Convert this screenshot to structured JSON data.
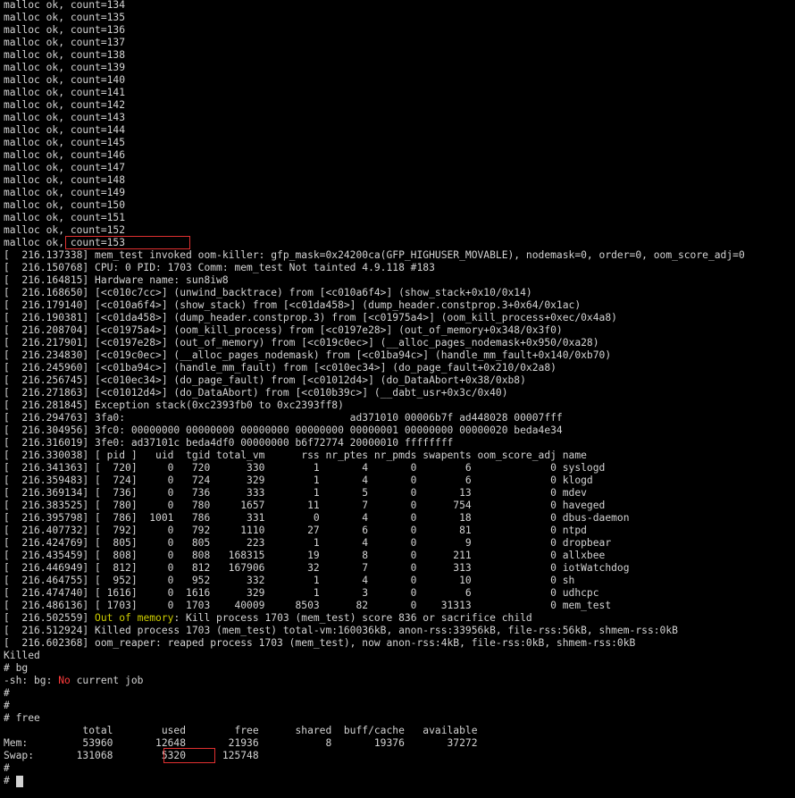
{
  "terminal": {
    "lines": [
      "malloc ok, count=134",
      "malloc ok, count=135",
      "malloc ok, count=136",
      "malloc ok, count=137",
      "malloc ok, count=138",
      "malloc ok, count=139",
      "malloc ok, count=140",
      "malloc ok, count=141",
      "malloc ok, count=142",
      "malloc ok, count=143",
      "malloc ok, count=144",
      "malloc ok, count=145",
      "malloc ok, count=146",
      "malloc ok, count=147",
      "malloc ok, count=148",
      "malloc ok, count=149",
      "malloc ok, count=150",
      "malloc ok, count=151",
      "malloc ok, count=152",
      "malloc ok, count=153",
      "[  216.137338] mem_test invoked oom-killer: gfp_mask=0x24200ca(GFP_HIGHUSER_MOVABLE), nodemask=0, order=0, oom_score_adj=0",
      "[  216.150768] CPU: 0 PID: 1703 Comm: mem_test Not tainted 4.9.118 #183",
      "[  216.164815] Hardware name: sun8iw8",
      "[  216.168650] [<c010c7cc>] (unwind_backtrace) from [<c010a6f4>] (show_stack+0x10/0x14)",
      "[  216.179140] [<c010a6f4>] (show_stack) from [<c01da458>] (dump_header.constprop.3+0x64/0x1ac)",
      "[  216.190381] [<c01da458>] (dump_header.constprop.3) from [<c01975a4>] (oom_kill_process+0xec/0x4a8)",
      "[  216.208704] [<c01975a4>] (oom_kill_process) from [<c0197e28>] (out_of_memory+0x348/0x3f0)",
      "[  216.217901] [<c0197e28>] (out_of_memory) from [<c019c0ec>] (__alloc_pages_nodemask+0x950/0xa28)",
      "[  216.234830] [<c019c0ec>] (__alloc_pages_nodemask) from [<c01ba94c>] (handle_mm_fault+0x140/0xb70)",
      "[  216.245960] [<c01ba94c>] (handle_mm_fault) from [<c010ec34>] (do_page_fault+0x210/0x2a8)",
      "[  216.256745] [<c010ec34>] (do_page_fault) from [<c01012d4>] (do_DataAbort+0x38/0xb8)",
      "[  216.271863] [<c01012d4>] (do_DataAbort) from [<c010b39c>] (__dabt_usr+0x3c/0x40)",
      "[  216.281845] Exception stack(0xc2393fb0 to 0xc2393ff8)",
      "[  216.294763] 3fa0:                                     ad371010 00006b7f ad448028 00007fff",
      "[  216.304956] 3fc0: 00000000 00000000 00000000 00000000 00000001 00000000 00000020 beda4e34",
      "[  216.316019] 3fe0: ad37101c beda4df0 00000000 b6f72774 20000010 ffffffff",
      "[  216.330038] [ pid ]   uid  tgid total_vm      rss nr_ptes nr_pmds swapents oom_score_adj name",
      "[  216.341363] [  720]     0   720      330        1       4       0        6             0 syslogd",
      "[  216.359483] [  724]     0   724      329        1       4       0        6             0 klogd",
      "[  216.369134] [  736]     0   736      333        1       5       0       13             0 mdev",
      "[  216.383525] [  780]     0   780     1657       11       7       0      754             0 haveged",
      "[  216.395798] [  786]  1001   786      331        0       4       0       18             0 dbus-daemon",
      "[  216.407732] [  792]     0   792     1110       27       6       0       81             0 ntpd",
      "[  216.424769] [  805]     0   805      223        1       4       0        9             0 dropbear",
      "[  216.435459] [  808]     0   808   168315       19       8       0      211             0 allxbee",
      "[  216.446949] [  812]     0   812   167906       32       7       0      313             0 iotWatchdog",
      "[  216.464755] [  952]     0   952      332        1       4       0       10             0 sh",
      "[  216.474740] [ 1616]     0  1616      329        1       3       0        6             0 udhcpc",
      "[  216.486136] [ 1703]     0  1703    40009     8503      82       0    31313             0 mem_test"
    ],
    "oom_prefix": "[  216.502559] ",
    "oom_highlight": "Out of memory",
    "oom_rest": ": Kill process 1703 (mem_test) score 836 or sacrifice child",
    "after_lines": [
      "[  216.512924] Killed process 1703 (mem_test) total-vm:160036kB, anon-rss:33956kB, file-rss:56kB, shmem-rss:0kB",
      "[  216.602368] oom_reaper: reaped process 1703 (mem_test), now anon-rss:4kB, file-rss:0kB, shmem-rss:0kB",
      "Killed",
      "# bg"
    ],
    "bg_prefix": "-sh: bg: ",
    "bg_highlight": "No",
    "bg_rest": " current job",
    "tail_lines": [
      "#",
      "#",
      "# free",
      "             total        used        free      shared  buff/cache   available",
      "Mem:         53960       12648       21936           8       19376       37272",
      "Swap:       131068        5320      125748",
      "#"
    ],
    "prompt": "# ",
    "colors": {
      "background": "#000000",
      "text": "#d3d3d3",
      "highlight_yellow": "#cdcd00",
      "highlight_red": "#ff3b3b",
      "box": "#e03030"
    }
  }
}
